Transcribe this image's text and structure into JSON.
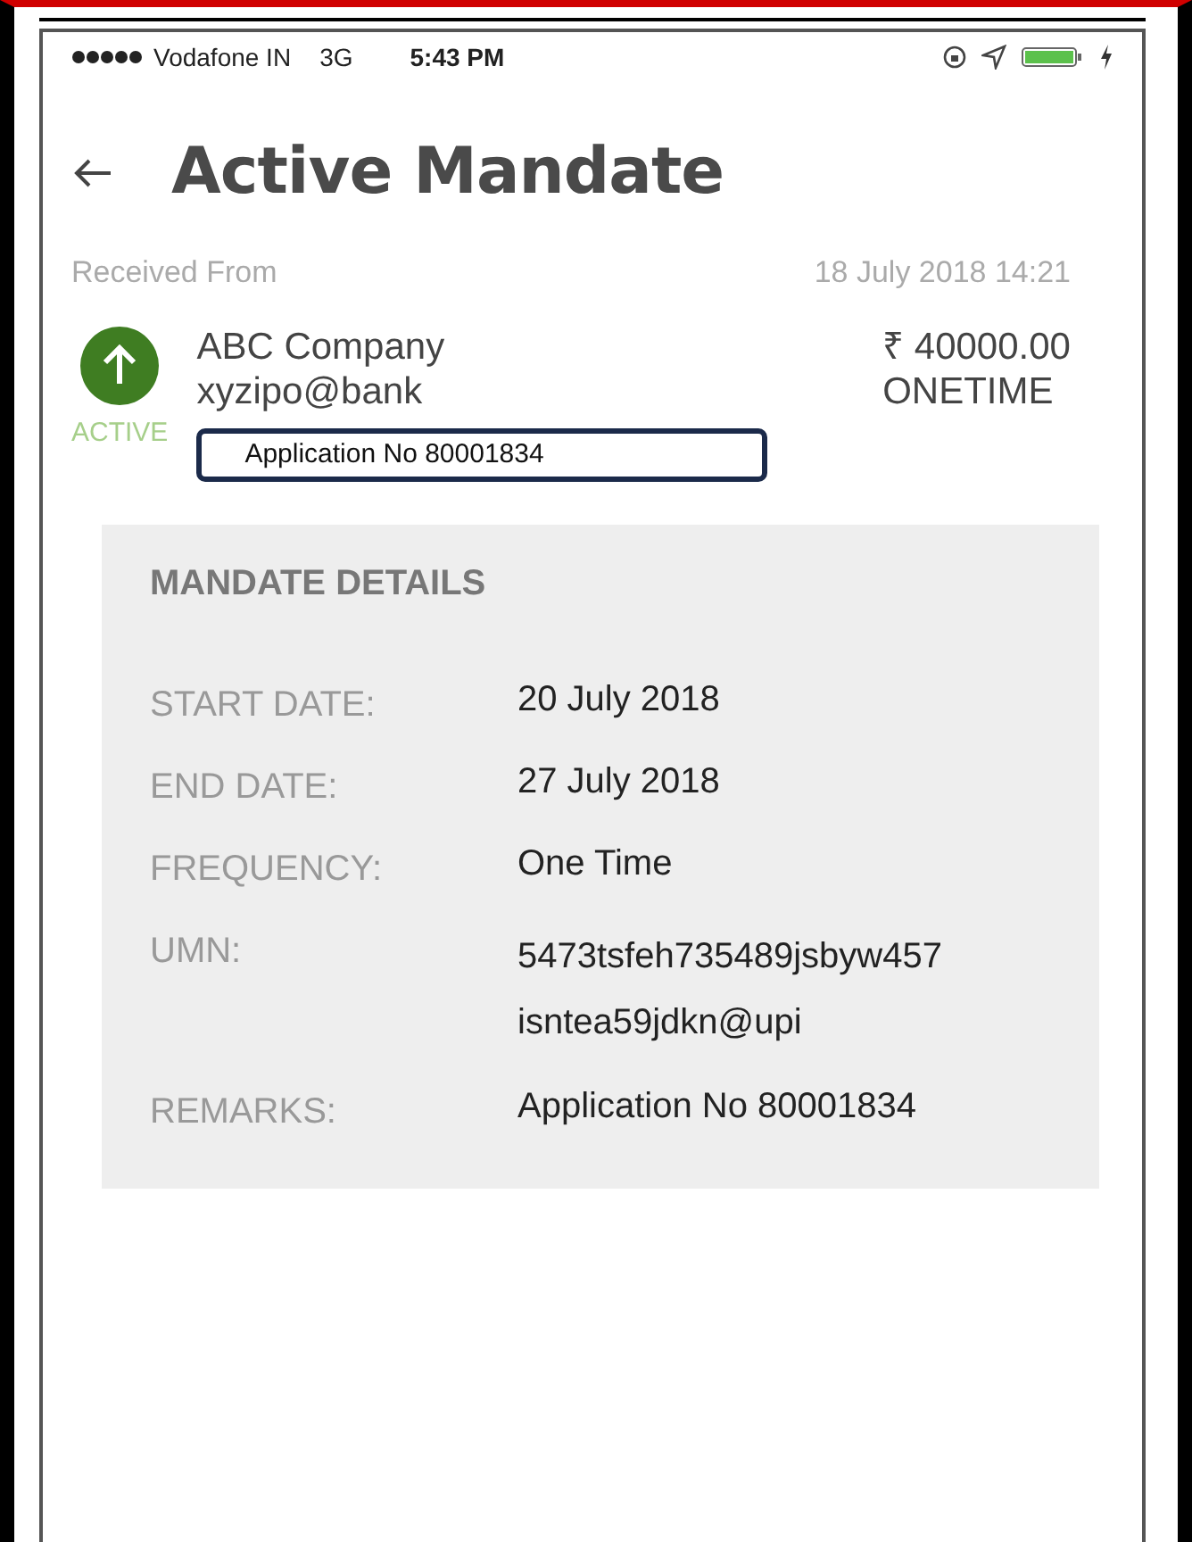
{
  "status_bar": {
    "carrier": "Vodafone IN",
    "network": "3G",
    "time": "5:43 PM"
  },
  "header": {
    "title": "Active Mandate"
  },
  "received": {
    "label": "Received From",
    "datetime": "18 July 2018 14:21"
  },
  "payer": {
    "name": "ABC Company",
    "vpa": "xyzipo@bank",
    "status": "ACTIVE",
    "amount": "₹ 40000.00",
    "frequency": "ONETIME",
    "note": "Application No 80001834"
  },
  "details": {
    "heading": "MANDATE DETAILS",
    "rows": [
      {
        "label": "START DATE:",
        "value_lines": [
          "20 July 2018"
        ]
      },
      {
        "label": "END DATE:",
        "value_lines": [
          "27 July 2018"
        ]
      },
      {
        "label": "FREQUENCY:",
        "value_lines": [
          "One Time"
        ]
      },
      {
        "label": "UMN:",
        "value_lines": [
          "5473tsfeh735489jsbyw457",
          "isntea59jdkn@upi"
        ]
      },
      {
        "label": "REMARKS:",
        "value_lines": [
          "Application No 80001834"
        ]
      }
    ]
  }
}
